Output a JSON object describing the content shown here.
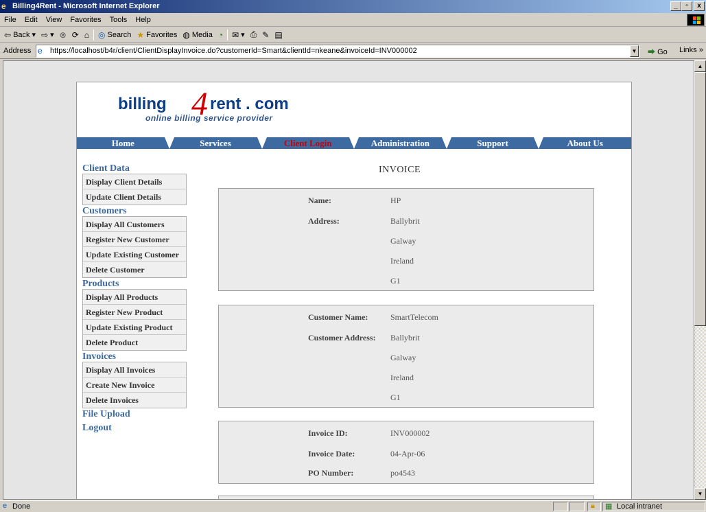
{
  "window": {
    "title": "Billing4Rent - Microsoft Internet Explorer",
    "min": "_",
    "max": "B",
    "close": "x"
  },
  "menu": [
    "File",
    "Edit",
    "View",
    "Favorites",
    "Tools",
    "Help"
  ],
  "toolbar": {
    "back": "Back",
    "search": "Search",
    "favorites": "Favorites",
    "media": "Media"
  },
  "address": {
    "label": "Address",
    "url": "https://localhost/b4r/client/ClientDisplayInvoice.do?customerId=Smart&clientId=nkeane&invoiceId=INV000002",
    "go": "Go",
    "links": "Links"
  },
  "logo": {
    "part1": "billing",
    "four": "4",
    "part2": "rent . com",
    "tagline": "online billing service provider"
  },
  "nav": [
    {
      "label": "Home",
      "active": false
    },
    {
      "label": "Services",
      "active": false
    },
    {
      "label": "Client Login",
      "active": true
    },
    {
      "label": "Administration",
      "active": false
    },
    {
      "label": "Support",
      "active": false
    },
    {
      "label": "About Us",
      "active": false
    }
  ],
  "sidebar": {
    "client_data": {
      "heading": "Client Data",
      "items": [
        "Display Client Details",
        "Update Client Details"
      ]
    },
    "customers": {
      "heading": "Customers",
      "items": [
        "Display All Customers",
        "Register New Customer",
        "Update Existing Customer",
        "Delete Customer"
      ]
    },
    "products": {
      "heading": "Products",
      "items": [
        "Display All Products",
        "Register New Product",
        "Update Existing Product",
        "Delete Product"
      ]
    },
    "invoices": {
      "heading": "Invoices",
      "items": [
        "Display All Invoices",
        "Create New Invoice",
        "Delete Invoices"
      ]
    },
    "file_upload": "File Upload",
    "logout": "Logout"
  },
  "invoice": {
    "title": "INVOICE",
    "client": {
      "name_label": "Name:",
      "name": "HP",
      "address_label": "Address:",
      "address": [
        "Ballybrit",
        "Galway",
        "Ireland",
        "G1"
      ]
    },
    "customer": {
      "name_label": "Customer Name:",
      "name": "SmartTelecom",
      "address_label": "Customer Address:",
      "address": [
        "Ballybrit",
        "Galway",
        "Ireland",
        "G1"
      ]
    },
    "details": {
      "id_label": "Invoice ID:",
      "id": "INV000002",
      "date_label": "Invoice Date:",
      "date": "04-Apr-06",
      "po_label": "PO Number:",
      "po": "po4543"
    }
  },
  "status": {
    "text": "Done",
    "zone": "Local intranet"
  }
}
